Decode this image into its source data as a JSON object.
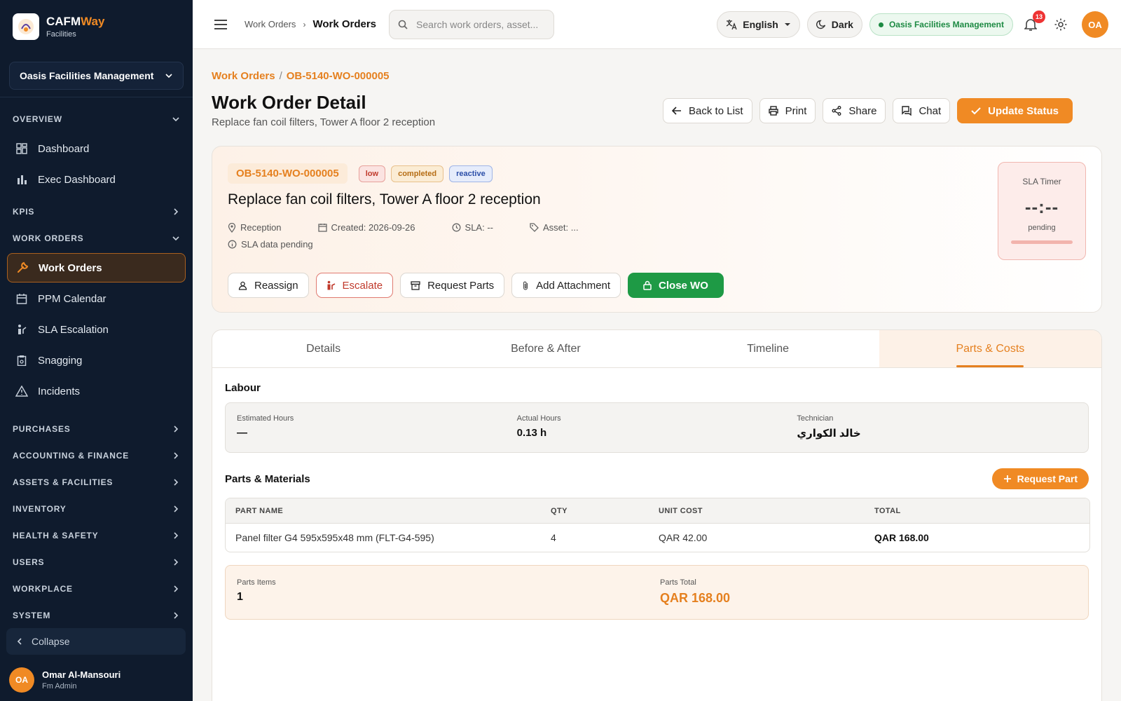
{
  "brand": {
    "name_a": "CAFM",
    "name_b": "Way",
    "sub": "Facilities"
  },
  "sidebar": {
    "org": "Oasis Facilities Management",
    "sections": {
      "overview": "OVERVIEW",
      "kpis": "KPIS",
      "work_orders": "WORK ORDERS",
      "purchases": "PURCHASES",
      "accounting": "ACCOUNTING & FINANCE",
      "assets": "ASSETS & FACILITIES",
      "inventory": "INVENTORY",
      "health": "HEALTH & SAFETY",
      "users": "USERS",
      "workplace": "WORKPLACE",
      "system": "SYSTEM"
    },
    "items": {
      "dashboard": "Dashboard",
      "exec": "Exec Dashboard",
      "work_orders": "Work Orders",
      "ppm": "PPM Calendar",
      "sla": "SLA Escalation",
      "snagging": "Snagging",
      "incidents": "Incidents"
    },
    "collapse": "Collapse",
    "user": {
      "initials": "OA",
      "name": "Omar Al-Mansouri",
      "role": "Fm Admin"
    }
  },
  "topbar": {
    "crumb1": "Work Orders",
    "crumb2": "Work Orders",
    "search_placeholder": "Search work orders, asset...",
    "language": "English",
    "theme": "Dark",
    "org": "Oasis Facilities Management",
    "notifications": "13",
    "avatar": "OA"
  },
  "page": {
    "breadcrumb": [
      "Work Orders",
      "OB-5140-WO-000005"
    ],
    "title": "Work Order Detail",
    "subtitle": "Replace fan coil filters, Tower A floor 2 reception",
    "actions": {
      "back": "Back to List",
      "print": "Print",
      "share": "Share",
      "chat": "Chat",
      "update": "Update Status"
    }
  },
  "wo": {
    "code": "OB-5140-WO-000005",
    "tags": {
      "priority": "low",
      "status": "completed",
      "type": "reactive"
    },
    "title": "Replace fan coil filters, Tower A floor 2 reception",
    "meta": {
      "location": "Reception",
      "created": "Created: 2026-09-26",
      "sla": "SLA: --",
      "asset": "Asset: ..."
    },
    "sla_note": "SLA data pending",
    "actions": {
      "reassign": "Reassign",
      "escalate": "Escalate",
      "request_parts": "Request Parts",
      "attachment": "Add Attachment",
      "close": "Close WO"
    },
    "sla_timer": {
      "label": "SLA Timer",
      "value": "--:--",
      "state": "pending"
    }
  },
  "tabs": [
    "Details",
    "Before & After",
    "Timeline",
    "Parts & Costs"
  ],
  "labour": {
    "title": "Labour",
    "estimated_label": "Estimated Hours",
    "estimated_value": "—",
    "actual_label": "Actual Hours",
    "actual_value": "0.13 h",
    "tech_label": "Technician",
    "tech_value": "خالد الكواري"
  },
  "parts": {
    "title": "Parts & Materials",
    "request_btn": "Request Part",
    "headers": [
      "PART NAME",
      "QTY",
      "UNIT COST",
      "TOTAL"
    ],
    "rows": [
      [
        "Panel filter G4 595x595x48 mm (FLT-G4-595)",
        "4",
        "QAR 42.00",
        "QAR 168.00"
      ]
    ]
  },
  "summary": {
    "items_label": "Parts Items",
    "items_value": "1",
    "total_label": "Parts Total",
    "total_value": "QAR 168.00"
  },
  "colors": {
    "accent": "#f08a24",
    "sidebar": "#0f1b2d",
    "success": "#1e9a45"
  }
}
